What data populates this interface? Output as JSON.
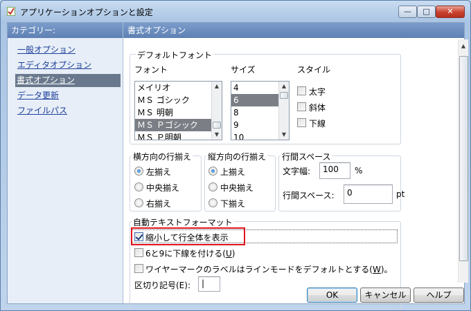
{
  "window": {
    "title": "アプリケーションオプションと設定",
    "controls": {
      "minimize": "—",
      "maximize": "□",
      "close": "✕"
    }
  },
  "sidebar": {
    "header": "カテゴリー:",
    "items": [
      {
        "label": "一般オプション",
        "selected": false
      },
      {
        "label": "エディタオプション",
        "selected": false
      },
      {
        "label": "書式オプション",
        "selected": true
      },
      {
        "label": "データ更新",
        "selected": false
      },
      {
        "label": "ファイルパス",
        "selected": false
      }
    ]
  },
  "panel": {
    "title": "書式オプション",
    "default_font": {
      "legend": "デフォルトフォント",
      "font_label": "フォント",
      "size_label": "サイズ",
      "style_label": "スタイル",
      "fonts": [
        "メイリオ",
        "ＭＳ ゴシック",
        "ＭＳ 明朝",
        "ＭＳ Ｐゴシック",
        "ＭＳ Ｐ明朝"
      ],
      "selected_font": "ＭＳ Ｐゴシック",
      "sizes": [
        "4",
        "6",
        "8",
        "9",
        "10"
      ],
      "selected_size": "6",
      "styles": [
        {
          "label": "太字",
          "checked": false
        },
        {
          "label": "斜体",
          "checked": false
        },
        {
          "label": "下線",
          "checked": false
        }
      ]
    },
    "horizontal_align": {
      "legend": "横方向の行揃え",
      "options": [
        "左揃え",
        "中央揃え",
        "右揃え"
      ],
      "selected": "左揃え"
    },
    "vertical_align": {
      "legend": "縦方向の行揃え",
      "options": [
        "上揃え",
        "中央揃え",
        "下揃え"
      ],
      "selected": "上揃え"
    },
    "spacing": {
      "legend": "行間スペース",
      "char_width_label": "文字幅:",
      "char_width_value": "100",
      "char_width_unit": "%",
      "line_space_label": "行間スペース:",
      "line_space_value": "0",
      "line_space_unit": "pt"
    },
    "auto_format": {
      "legend": "自動テキストフォーマット",
      "shrink_to_fit": {
        "label": "縮小して行全体を表示",
        "checked": true
      },
      "underline_6_9": {
        "label_main": "6と9に下線を付ける(",
        "label_key": "U",
        "label_end": ")",
        "checked": false
      },
      "wireframe": {
        "label_main": "ワイヤーマークのラベルはラインモードをデフォルトとする(",
        "label_key": "W",
        "label_end": ")。",
        "checked": false
      },
      "delimiter_label": "区切り記号(E):",
      "delimiter_value": "|"
    }
  },
  "buttons": {
    "ok": "OK",
    "cancel": "キャンセル",
    "help": "ヘルプ"
  },
  "colors": {
    "highlight": "#e0141e",
    "header_bar": "#5e80b3",
    "selected_item": "#69788c"
  }
}
